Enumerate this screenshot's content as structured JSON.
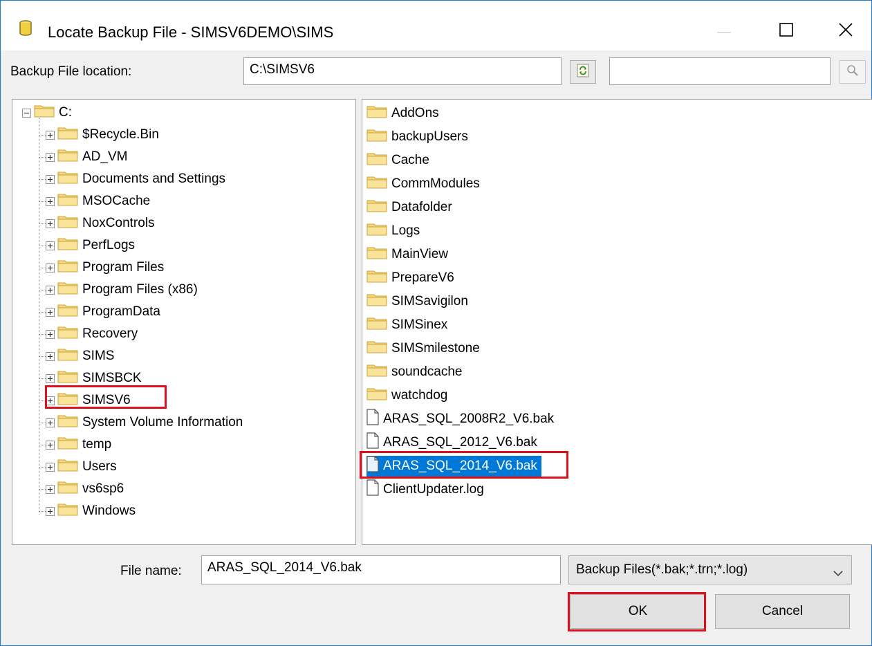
{
  "window": {
    "title": "Locate Backup File - SIMSV6DEMO\\SIMS",
    "icon": "database-icon",
    "controls": [
      "minimize-icon",
      "maximize-icon",
      "close-icon"
    ]
  },
  "location": {
    "label": "Backup File location:",
    "value": "C:\\SIMSV6",
    "refresh_icon": "refresh-icon",
    "search_value": "",
    "search_icon": "search-icon"
  },
  "tree": {
    "root": "C:",
    "items": [
      "$Recycle.Bin",
      "AD_VM",
      "Documents and Settings",
      "MSOCache",
      "NoxControls",
      "PerfLogs",
      "Program Files",
      "Program Files (x86)",
      "ProgramData",
      "Recovery",
      "SIMS",
      "SIMSBCK",
      "SIMSV6",
      "System Volume Information",
      "temp",
      "Users",
      "vs6sp6",
      "Windows"
    ],
    "highlighted_item": "SIMSV6"
  },
  "files": {
    "folders": [
      "AddOns",
      "backupUsers",
      "Cache",
      "CommModules",
      "Datafolder",
      "Logs",
      "MainView",
      "PrepareV6",
      "SIMSavigilon",
      "SIMSinex",
      "SIMSmilestone",
      "soundcache",
      "watchdog"
    ],
    "documents": [
      "ARAS_SQL_2008R2_V6.bak",
      "ARAS_SQL_2012_V6.bak",
      "ARAS_SQL_2014_V6.bak",
      "ClientUpdater.log"
    ],
    "selected": "ARAS_SQL_2014_V6.bak"
  },
  "footer": {
    "file_name_label": "File name:",
    "file_name_value": "ARAS_SQL_2014_V6.bak",
    "filter_value": "Backup Files(*.bak;*.trn;*.log)",
    "ok_label": "OK",
    "cancel_label": "Cancel"
  },
  "colors": {
    "selection": "#0078d7",
    "highlight": "#e0101a",
    "folder": "#f5d77a"
  }
}
